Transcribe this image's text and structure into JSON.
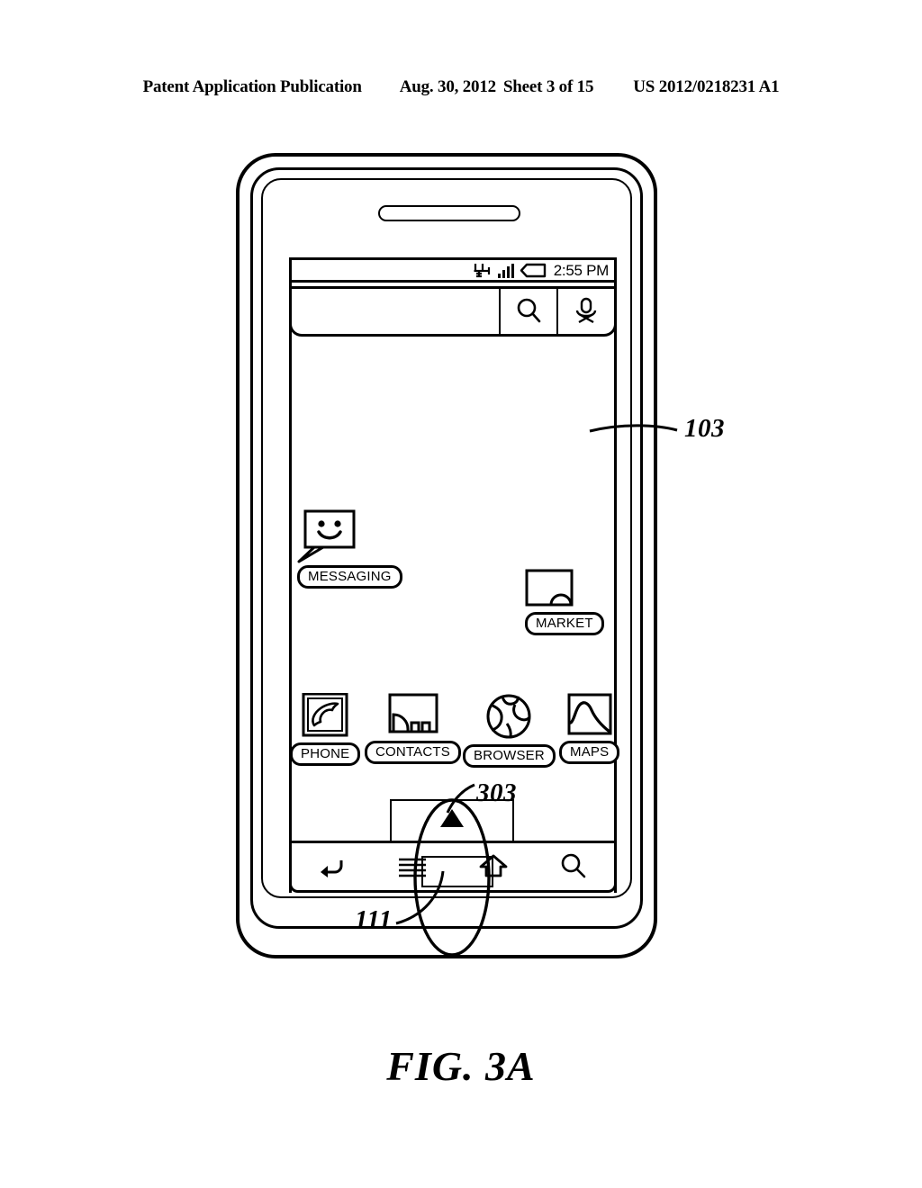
{
  "header": {
    "publication": "Patent Application Publication",
    "date": "Aug. 30, 2012",
    "sheet": "Sheet 3 of 15",
    "patent_number": "US 2012/0218231 A1"
  },
  "figure": {
    "caption": "FIG. 3A"
  },
  "device": {
    "status_bar": {
      "time": "2:55 PM",
      "icons": [
        "network-icon",
        "signal-bars-icon",
        "battery-icon"
      ]
    },
    "search_widget": {
      "query": "",
      "placeholder": "",
      "search_icon": "magnifier-icon",
      "voice_icon": "microphone-icon"
    },
    "desktop_apps": [
      {
        "label": "MESSAGING",
        "icon": "message-bubble-icon"
      },
      {
        "label": "MARKET",
        "icon": "market-bag-icon"
      }
    ],
    "dock_apps": [
      {
        "label": "PHONE",
        "icon": "phone-handset-icon"
      },
      {
        "label": "CONTACTS",
        "icon": "contacts-icon"
      },
      {
        "label": "BROWSER",
        "icon": "globe-icon"
      },
      {
        "label": "MAPS",
        "icon": "map-icon"
      }
    ],
    "drawer_handle": {
      "icon": "up-triangle-icon"
    },
    "nav_bar": {
      "buttons": [
        {
          "label": "",
          "icon": "back-arrow-icon"
        },
        {
          "label": "",
          "icon": "menu-lines-icon"
        },
        {
          "label": "",
          "icon": "home-house-icon"
        },
        {
          "label": "",
          "icon": "search-magnifier-icon"
        }
      ]
    }
  },
  "reference_numerals": {
    "screen": "103",
    "drawer_handle": "303",
    "nav_bar": "111"
  },
  "colors": {
    "line": "#000000",
    "background": "#ffffff"
  }
}
